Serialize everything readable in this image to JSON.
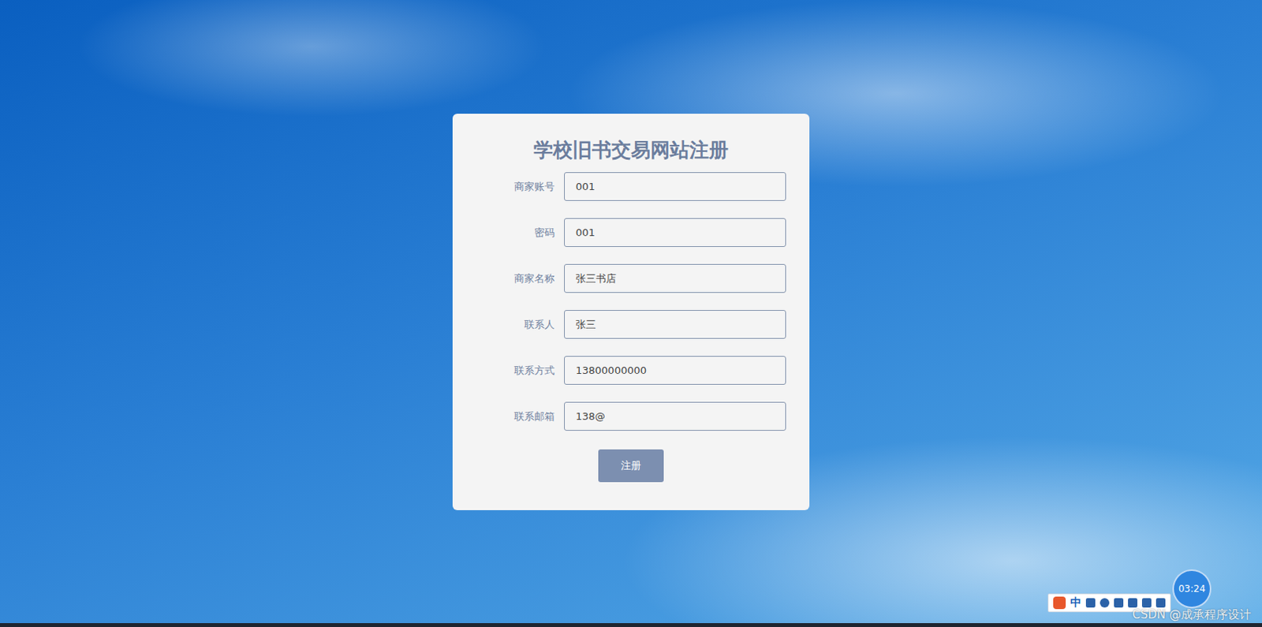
{
  "page": {
    "title": "学校旧书交易网站注册"
  },
  "fields": [
    {
      "label": "商家账号",
      "value": "001"
    },
    {
      "label": "密码",
      "value": "001"
    },
    {
      "label": "商家名称",
      "value": "张三书店"
    },
    {
      "label": "联系人",
      "value": "张三"
    },
    {
      "label": "联系方式",
      "value": "13800000000"
    },
    {
      "label": "联系邮箱",
      "value": "138@"
    }
  ],
  "buttons": [
    "注册"
  ],
  "overlay": {
    "timer": "03:24",
    "ime": "中",
    "watermark": "CSDN @成承程序设计"
  }
}
